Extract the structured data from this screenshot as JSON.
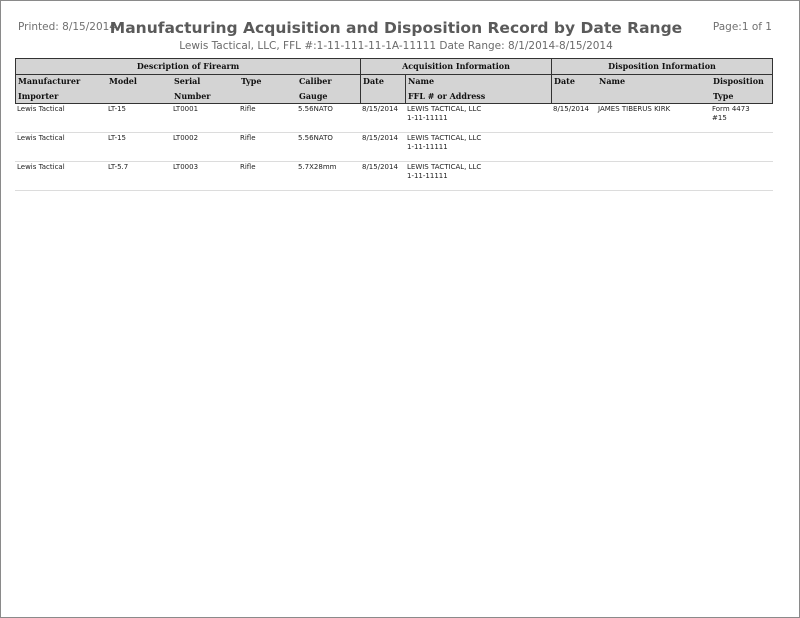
{
  "report": {
    "printed": "Printed: 8/15/2014",
    "title": "Manufacturing Acquisition and Disposition Record by Date Range",
    "subtitle": "Lewis Tactical, LLC, FFL #:1-11-111-11-1A-11111 Date Range: 8/1/2014-8/15/2014",
    "page": "Page:1 of 1"
  },
  "groups": {
    "description": "Description of Firearm",
    "acquisition": "Acquisition Information",
    "disposition": "Disposition Information"
  },
  "columns": {
    "manufacturer": "Manufacturer",
    "importer": "Importer",
    "model": "Model",
    "serial1": "Serial",
    "serial2": "Number",
    "type": "Type",
    "caliber": "Caliber",
    "gauge": "Gauge",
    "acq_date": "Date",
    "acq_name": "Name",
    "acq_ffl": "FFL # or Address",
    "disp_date": "Date",
    "disp_name": "Name",
    "disposition": "Disposition",
    "disp_type": "Type"
  },
  "rows": [
    {
      "manufacturer": "Lewis Tactical",
      "model": "LT-15",
      "serial": "LT0001",
      "type": "Rifle",
      "caliber": "5.56NATO",
      "acq_date": "8/15/2014",
      "acq_name": "LEWIS TACTICAL, LLC",
      "acq_ffl": "1-11-11111",
      "disp_date": "8/15/2014",
      "disp_name": "JAMES TIBERUS KIRK",
      "disposition": "Form 4473",
      "disp_type": "#15"
    },
    {
      "manufacturer": "Lewis Tactical",
      "model": "LT-15",
      "serial": "LT0002",
      "type": "Rifle",
      "caliber": "5.56NATO",
      "acq_date": "8/15/2014",
      "acq_name": "LEWIS TACTICAL, LLC",
      "acq_ffl": "1-11-11111",
      "disp_date": "",
      "disp_name": "",
      "disposition": "",
      "disp_type": ""
    },
    {
      "manufacturer": "Lewis Tactical",
      "model": "LT-5.7",
      "serial": "LT0003",
      "type": "Rifle",
      "caliber": "5.7X28mm",
      "acq_date": "8/15/2014",
      "acq_name": "LEWIS TACTICAL, LLC",
      "acq_ffl": "1-11-11111",
      "disp_date": "",
      "disp_name": "",
      "disposition": "",
      "disp_type": ""
    }
  ]
}
